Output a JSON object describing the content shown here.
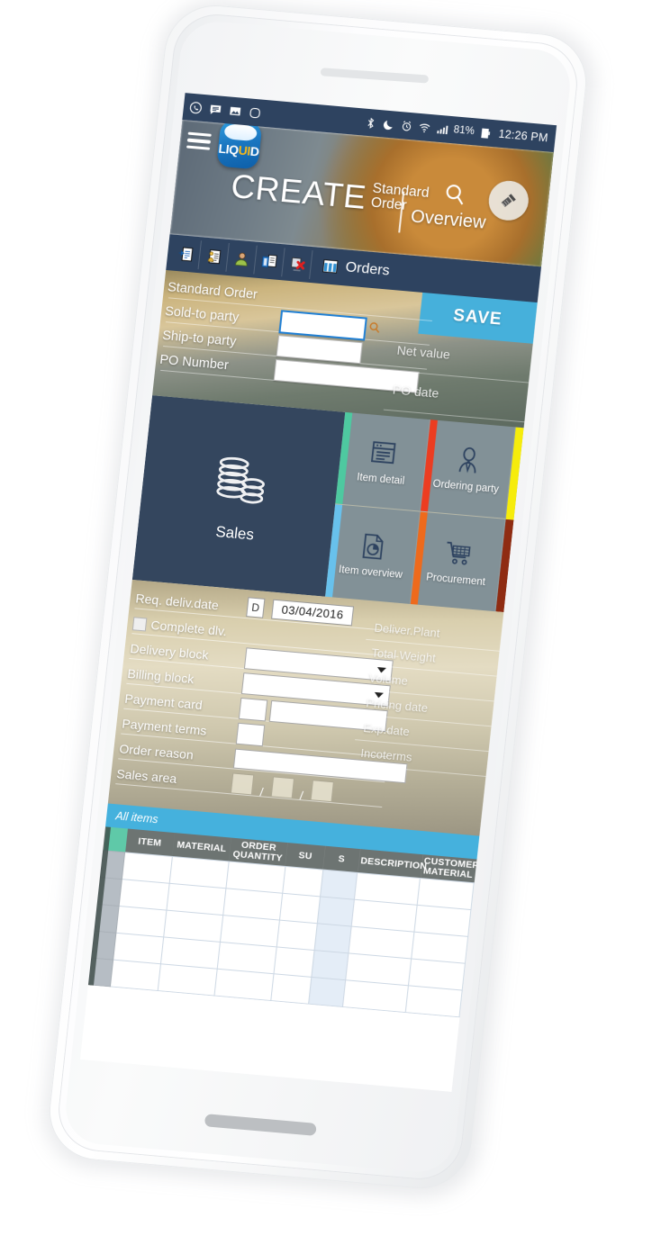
{
  "statusbar": {
    "icons_left": [
      "whatsapp-icon",
      "message-icon",
      "image-icon",
      "app-icon"
    ],
    "icons_right": [
      "bluetooth-icon",
      "do-not-disturb-icon",
      "alarm-icon",
      "wifi-icon",
      "signal-icon"
    ],
    "battery_percent": "81%",
    "time": "12:26 PM"
  },
  "header": {
    "menu": "menu-icon",
    "logo_part1": "LIQ",
    "logo_part2": "UI",
    "logo_part3": "D",
    "title_main": "CREATE",
    "title_sub": "Standard Order",
    "overview_label": "Overview",
    "search_icon": "search-icon",
    "fab_icon": "tool-icon"
  },
  "apptoolbar": {
    "icons": [
      {
        "name": "new-document-icon"
      },
      {
        "name": "document-person-icon"
      },
      {
        "name": "customer-icon"
      },
      {
        "name": "copy-document-icon"
      },
      {
        "name": "delete-document-icon"
      }
    ],
    "orders_icon": "grid-icon",
    "orders_label": "Orders"
  },
  "form_top": {
    "save_label": "SAVE",
    "fields": [
      {
        "label": "Standard Order",
        "value": ""
      },
      {
        "label": "Sold-to party",
        "value": ""
      },
      {
        "label": "Ship-to party",
        "value": ""
      },
      {
        "label": "PO Number",
        "value": ""
      }
    ],
    "right_fields": [
      {
        "label": "Net value",
        "value": ""
      },
      {
        "label": "PO date",
        "value": ""
      }
    ]
  },
  "tiles": {
    "main": {
      "label": "Sales",
      "icon": "coins-stack-icon",
      "color": "#34465e"
    },
    "items": [
      {
        "label": "Item detail",
        "icon": "document-window-icon",
        "accent": "#4ec9a0"
      },
      {
        "label": "Ordering party",
        "icon": "person-tie-icon",
        "accent": "#ec3d21"
      },
      {
        "label": "Item overview",
        "icon": "document-chart-icon",
        "accent": "#68c1ec"
      },
      {
        "label": "Procurement",
        "icon": "shopping-cart-icon",
        "accent": "#ee6a1c"
      }
    ],
    "edge_accents": [
      "#f6ec0c",
      "#8f2c12"
    ]
  },
  "form_bottom": {
    "req_deliv_label": "Req. deliv.date",
    "req_deliv_type": "D",
    "req_deliv_date": "03/04/2016",
    "complete_dlv_label": "Complete dlv.",
    "complete_dlv_checked": false,
    "delivery_block_label": "Delivery block",
    "delivery_block_value": "",
    "billing_block_label": "Billing block",
    "billing_block_value": "",
    "payment_card_label": "Payment card",
    "payment_card_value": "",
    "payment_terms_label": "Payment terms",
    "payment_terms_value": "",
    "order_reason_label": "Order reason",
    "order_reason_value": "",
    "sales_area_label": "Sales area",
    "sales_area_sep": "/",
    "right_fields": [
      {
        "label": "Deliver.Plant"
      },
      {
        "label": "Total Weight"
      },
      {
        "label": "Volume"
      },
      {
        "label": "Pricing date"
      },
      {
        "label": "Exp.date"
      },
      {
        "label": "Incoterms"
      }
    ]
  },
  "items_table": {
    "title": "All items",
    "columns": [
      "ITEM",
      "MATERIAL",
      "ORDER QUANTITY",
      "SU",
      "S",
      "DESCRIPTION",
      "CUSTOMER MATERIAL"
    ],
    "rows": [
      [
        "",
        "",
        "",
        "",
        "",
        "",
        ""
      ],
      [
        "",
        "",
        "",
        "",
        "",
        "",
        ""
      ],
      [
        "",
        "",
        "",
        "",
        "",
        "",
        ""
      ],
      [
        "",
        "",
        "",
        "",
        "",
        "",
        ""
      ],
      [
        "",
        "",
        "",
        "",
        "",
        "",
        ""
      ]
    ]
  },
  "colors": {
    "status_bar": "#2e4360",
    "toolbar": "#2e4360",
    "save": "#46b0db",
    "table_title": "#45b1dd",
    "tile_main": "#34465e",
    "table_header": "#6d7472"
  }
}
